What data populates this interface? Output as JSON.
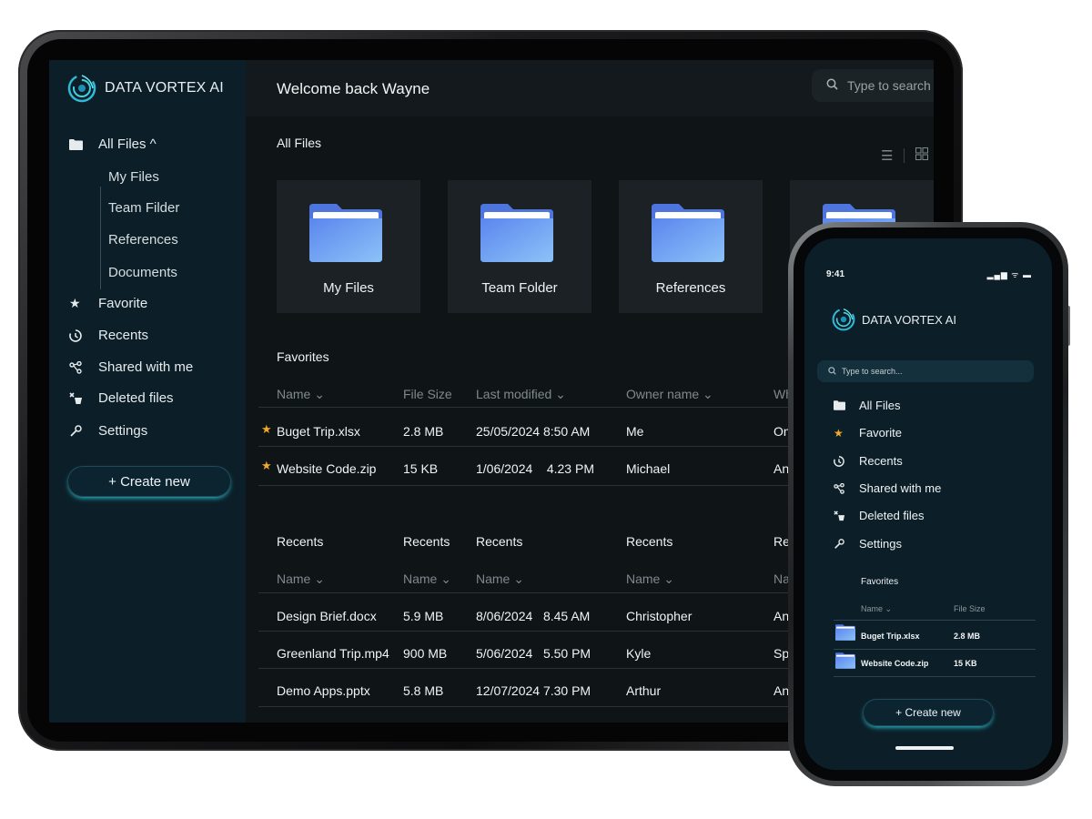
{
  "brand": {
    "name": "DATA VORTEX AI"
  },
  "tablet": {
    "welcome": "Welcome back Wayne",
    "search": {
      "placeholder": "Type to search"
    },
    "sidebar": {
      "all_files": "All Files ^",
      "sub_items": [
        "My Files",
        "Team Filder",
        "References",
        "Documents"
      ],
      "items": [
        {
          "label": "Favorite",
          "icon": "star-icon"
        },
        {
          "label": "Recents",
          "icon": "history-icon"
        },
        {
          "label": "Shared with me",
          "icon": "share-icon"
        },
        {
          "label": "Deleted files",
          "icon": "deleted-icon"
        },
        {
          "label": "Settings",
          "icon": "wrench-icon"
        }
      ],
      "create_label": "+ Create new"
    },
    "all_files_title": "All Files",
    "folders": [
      "My Files",
      "Team Folder",
      "References",
      ""
    ],
    "favorites": {
      "title": "Favorites",
      "headers": [
        "Name ⌄",
        "File Size",
        "Last modified ⌄",
        "Owner name ⌄",
        "Wh"
      ],
      "rows": [
        {
          "name": "Buget Trip.xlsx",
          "size": "2.8 MB",
          "modified": "25/05/2024 8:50 AM",
          "owner": "Me",
          "extra": "On"
        },
        {
          "name": "Website Code.zip",
          "size": "15 KB",
          "modified": "1/06/2024    4.23 PM",
          "owner": "Michael",
          "extra": "An"
        }
      ]
    },
    "recents": {
      "col_titles": [
        "Recents",
        "Recents",
        "Recents",
        "Recents",
        "Re"
      ],
      "headers": [
        "Name ⌄",
        "Name ⌄",
        "Name ⌄",
        "Name ⌄",
        "Na"
      ],
      "rows": [
        {
          "name": "Design Brief.docx",
          "size": "5.9 MB",
          "modified": "8/06/2024   8.45 AM",
          "owner": "Christopher",
          "extra": "An"
        },
        {
          "name": "Greenland Trip.mp4",
          "size": "900 MB",
          "modified": "5/06/2024   5.50 PM",
          "owner": "Kyle",
          "extra": "Sp"
        },
        {
          "name": "Demo Apps.pptx",
          "size": "5.8 MB",
          "modified": "12/07/2024 7.30 PM",
          "owner": "Arthur",
          "extra": "An"
        }
      ]
    }
  },
  "phone": {
    "time": "9:41",
    "status_icons": "▂▄▆ ᯤ ▬",
    "search": {
      "placeholder": "Type to search..."
    },
    "items": [
      {
        "label": "All Files",
        "icon": "folder-icon"
      },
      {
        "label": "Favorite",
        "icon": "star-icon"
      },
      {
        "label": "Recents",
        "icon": "history-icon"
      },
      {
        "label": "Shared with me",
        "icon": "share-icon"
      },
      {
        "label": "Deleted files",
        "icon": "deleted-icon"
      },
      {
        "label": "Settings",
        "icon": "wrench-icon"
      }
    ],
    "favorites": {
      "title": "Favorites",
      "headers": [
        "Name ⌄",
        "File Size"
      ],
      "rows": [
        {
          "name": "Buget Trip.xlsx",
          "size": "2.8 MB"
        },
        {
          "name": "Website Code.zip",
          "size": "15 KB"
        }
      ]
    },
    "create_label": "+ Create new"
  },
  "colors": {
    "accent": "#2fd3e6",
    "folder": "#6b9cf5",
    "star": "#f0a92b",
    "sidebar": "#0c1f28",
    "main": "#0f1417"
  }
}
